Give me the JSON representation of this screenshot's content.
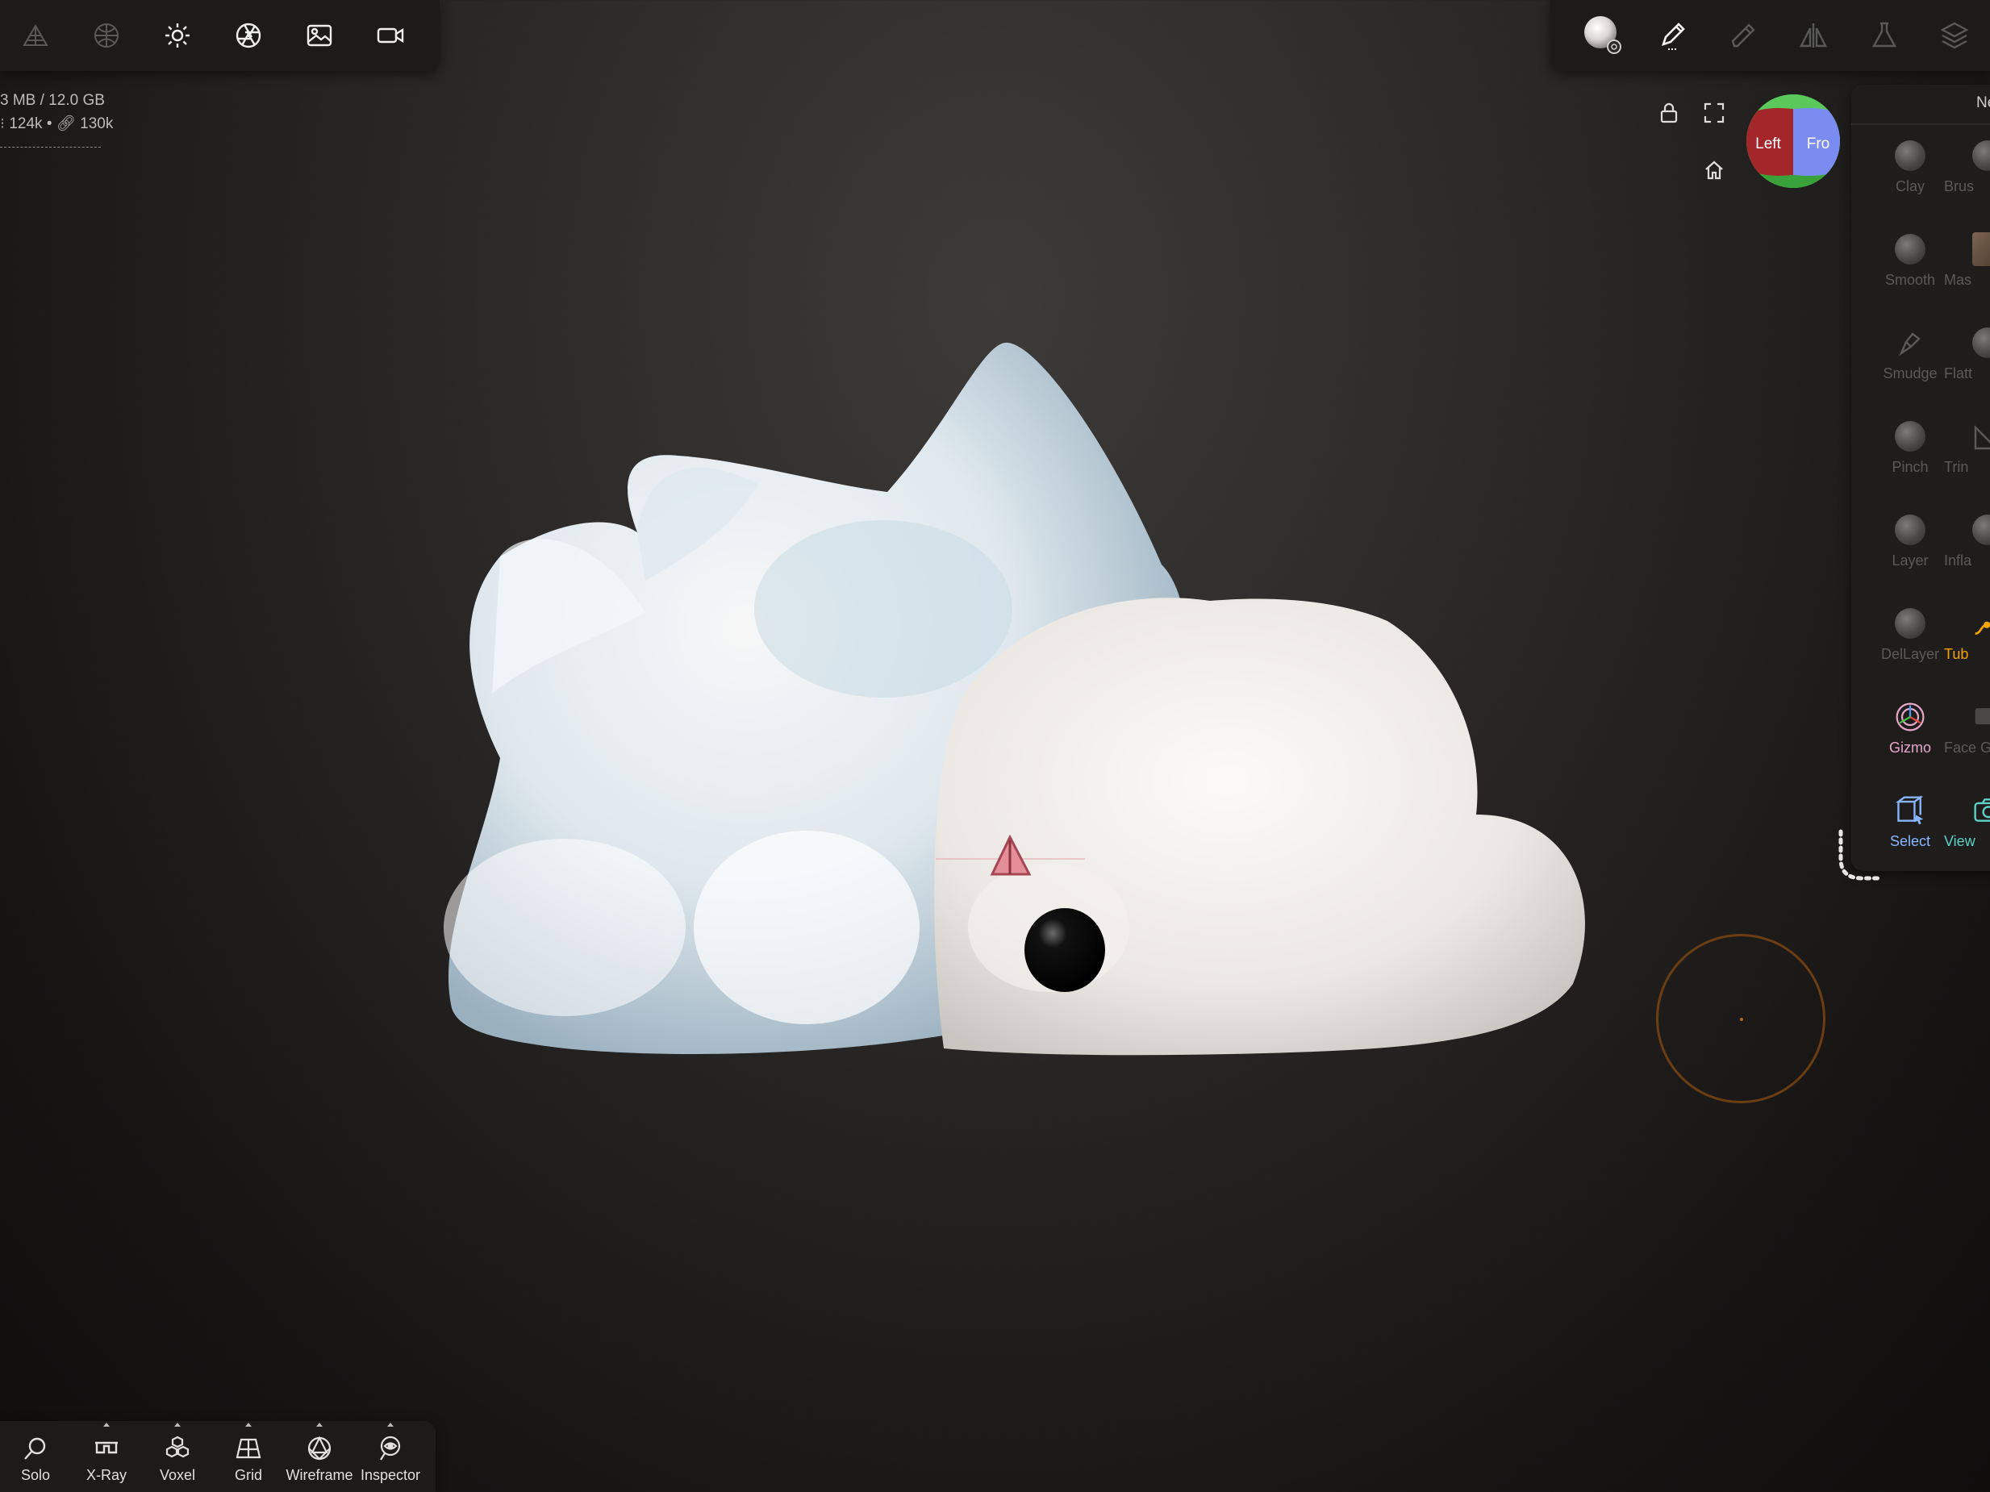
{
  "stats": {
    "memory": "3 MB / 12.0 GB",
    "vertices": "124k",
    "faces": "130k",
    "faces_separator": "•"
  },
  "top_left_toolbar": {
    "icons": [
      "topology-icon",
      "matcap-sphere-icon",
      "sun-icon",
      "aperture-icon",
      "image-icon",
      "video-camera-icon"
    ]
  },
  "top_right_toolbar": {
    "icons": [
      "material-sphere-icon",
      "brush-pen-icon",
      "picker-icon",
      "symmetry-icon",
      "flask-icon",
      "layers-icon"
    ]
  },
  "viewport": {
    "orientation_cube": {
      "left_label": "Left",
      "front_label": "Fro",
      "colors": {
        "left": "#a3262a",
        "front": "#7b8cf0",
        "top": "#5ac85a",
        "bottom": "#3aa23a"
      }
    }
  },
  "right_panel": {
    "header": "Ne",
    "tools_col1": [
      {
        "name": "clay",
        "label": "Clay"
      },
      {
        "name": "smooth",
        "label": "Smooth"
      },
      {
        "name": "smudge",
        "label": "Smudge"
      },
      {
        "name": "pinch",
        "label": "Pinch"
      },
      {
        "name": "layer",
        "label": "Layer"
      },
      {
        "name": "dellayer",
        "label": "DelLayer"
      },
      {
        "name": "gizmo",
        "label": "Gizmo"
      },
      {
        "name": "select",
        "label": "Select"
      }
    ],
    "tools_col2": [
      {
        "name": "brush",
        "label": "Brus"
      },
      {
        "name": "mask",
        "label": "Mas"
      },
      {
        "name": "flatten",
        "label": "Flatt"
      },
      {
        "name": "trim",
        "label": "Trin"
      },
      {
        "name": "inflate",
        "label": "Infla"
      },
      {
        "name": "tube",
        "label": "Tub"
      },
      {
        "name": "face-group",
        "label": "Face Gr"
      },
      {
        "name": "view",
        "label": "View"
      }
    ]
  },
  "bottom_bar": {
    "items": [
      {
        "name": "solo",
        "label": "Solo"
      },
      {
        "name": "xray",
        "label": "X-Ray"
      },
      {
        "name": "voxel",
        "label": "Voxel"
      },
      {
        "name": "grid",
        "label": "Grid"
      },
      {
        "name": "wireframe",
        "label": "Wireframe"
      },
      {
        "name": "inspector",
        "label": "Inspector"
      }
    ]
  },
  "colors": {
    "accent_orange": "#f4a300",
    "gizmo_pink": "#e8a6c8",
    "select_blue": "#8ab6ff",
    "view_teal": "#5fd1c7",
    "brush_circle": "#6a3e12"
  }
}
